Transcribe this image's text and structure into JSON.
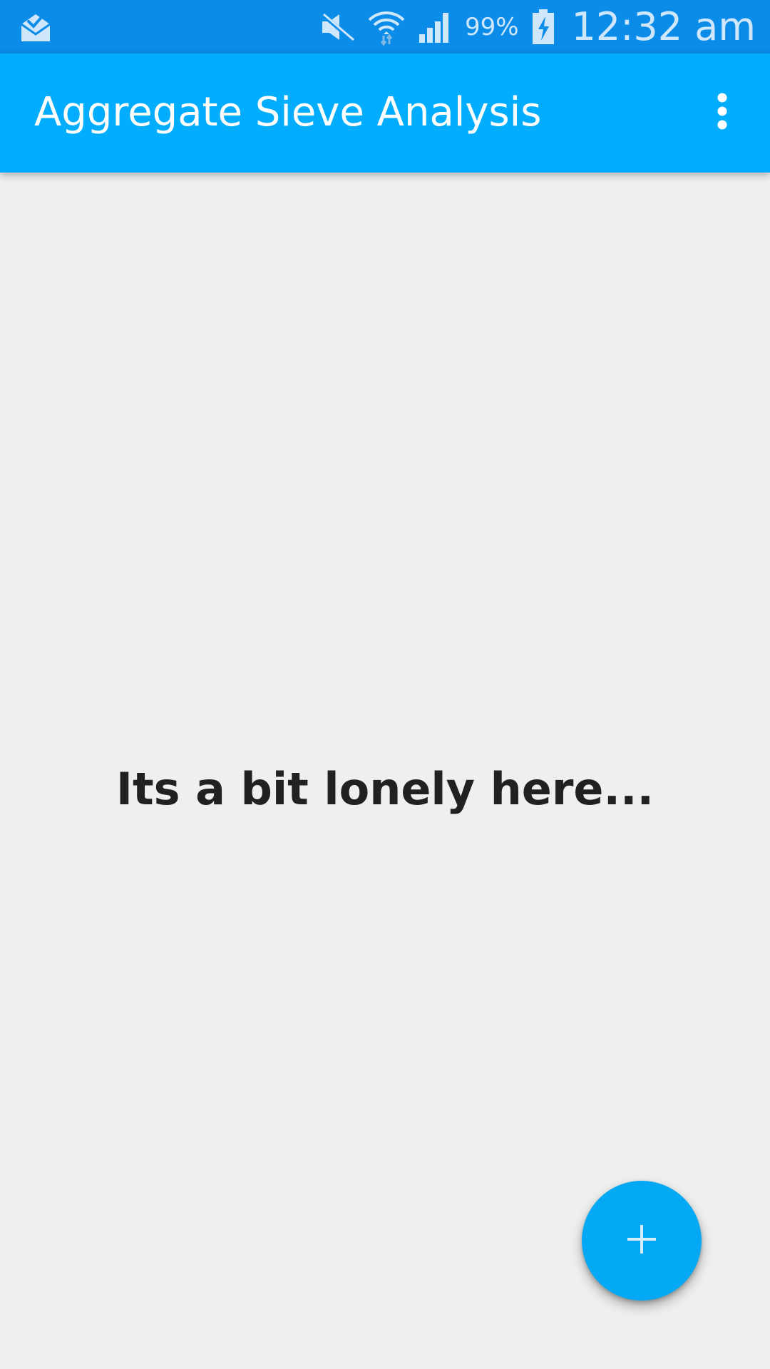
{
  "status_bar": {
    "notification_icon": "mail-check-icon",
    "icons": [
      "mute-icon",
      "wifi-icon",
      "signal-icon",
      "battery-charging-icon"
    ],
    "battery_percent": "99%",
    "time": "12:32 am",
    "background_color": "#0b8ce9"
  },
  "app_bar": {
    "title": "Aggregate Sieve Analysis",
    "menu_icon": "more-vert-icon",
    "background_color": "#02adfd"
  },
  "main": {
    "empty_message": "Its a bit lonely here..."
  },
  "fab": {
    "icon": "plus-icon",
    "color": "#03a9f4"
  }
}
